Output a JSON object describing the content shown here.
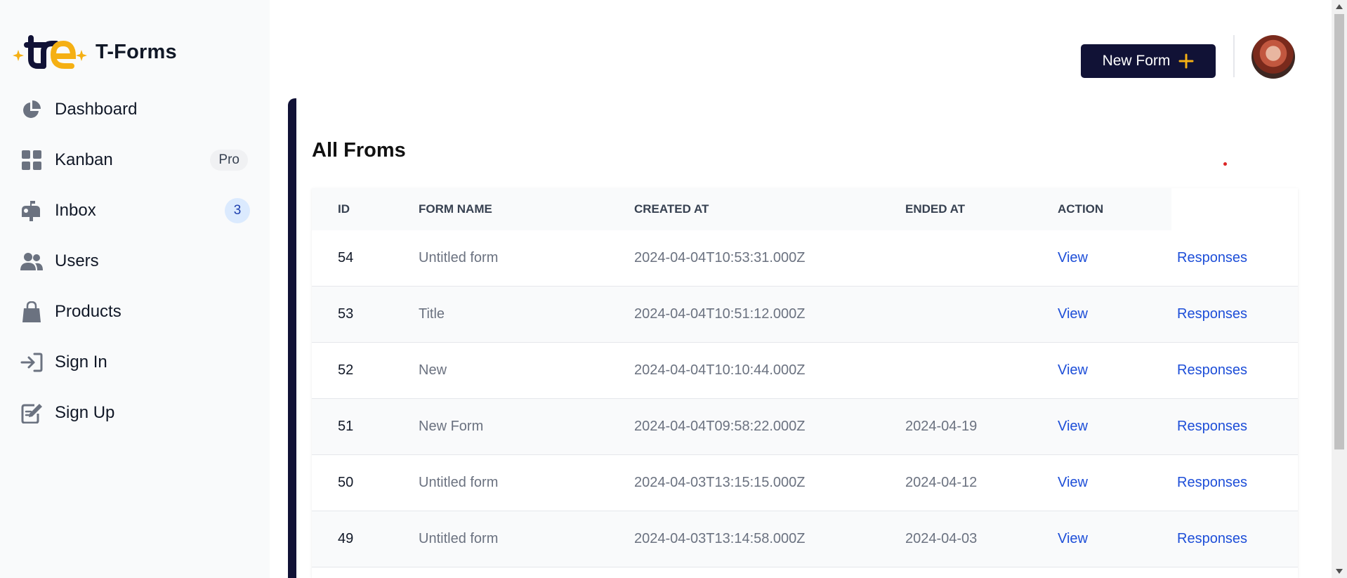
{
  "brand": {
    "name": "T-Forms",
    "accent": "#f5b014",
    "dark": "#111236"
  },
  "sidebar": {
    "items": [
      {
        "label": "Dashboard",
        "icon": "pie-chart-icon"
      },
      {
        "label": "Kanban",
        "icon": "grid-icon",
        "badge": "Pro"
      },
      {
        "label": "Inbox",
        "icon": "mailbox-icon",
        "badge": "3"
      },
      {
        "label": "Users",
        "icon": "users-icon"
      },
      {
        "label": "Products",
        "icon": "shopping-bag-icon"
      },
      {
        "label": "Sign In",
        "icon": "sign-in-icon"
      },
      {
        "label": "Sign Up",
        "icon": "sign-up-icon"
      }
    ]
  },
  "header": {
    "new_form_label": "New Form"
  },
  "main": {
    "title": "All Froms",
    "columns": [
      "ID",
      "FORM NAME",
      "CREATED AT",
      "ENDED AT",
      "ACTION"
    ],
    "rows": [
      {
        "id": "54",
        "name": "Untitled form",
        "created": "2024-04-04T10:53:31.000Z",
        "ended": "",
        "view": "View",
        "responses": "Responses"
      },
      {
        "id": "53",
        "name": "Title",
        "created": "2024-04-04T10:51:12.000Z",
        "ended": "",
        "view": "View",
        "responses": "Responses"
      },
      {
        "id": "52",
        "name": "New",
        "created": "2024-04-04T10:10:44.000Z",
        "ended": "",
        "view": "View",
        "responses": "Responses"
      },
      {
        "id": "51",
        "name": "New Form",
        "created": "2024-04-04T09:58:22.000Z",
        "ended": "2024-04-19",
        "view": "View",
        "responses": "Responses"
      },
      {
        "id": "50",
        "name": "Untitled form",
        "created": "2024-04-03T13:15:15.000Z",
        "ended": "2024-04-12",
        "view": "View",
        "responses": "Responses"
      },
      {
        "id": "49",
        "name": "Untitled form",
        "created": "2024-04-03T13:14:58.000Z",
        "ended": "2024-04-03",
        "view": "View",
        "responses": "Responses"
      }
    ]
  }
}
